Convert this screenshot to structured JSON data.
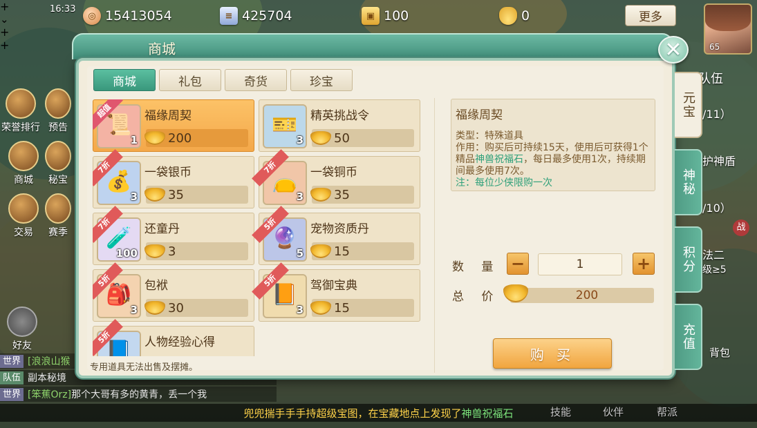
{
  "hud": {
    "clock": "16:33",
    "resources": [
      {
        "icon": "copper-coin-icon",
        "value": "15413054",
        "action": "plus"
      },
      {
        "icon": "silver-scroll-icon",
        "value": "425704",
        "action": "expand"
      },
      {
        "icon": "jade-token-icon",
        "value": "100",
        "action": "plus"
      },
      {
        "icon": "gold-ingot-icon",
        "value": "0",
        "action": "plus"
      }
    ],
    "more_label": "更多",
    "avatar_level": "65"
  },
  "left_menu": [
    {
      "label": "荣誉排行"
    },
    {
      "label": "预告"
    },
    {
      "label": "商城"
    },
    {
      "label": "秘宝"
    },
    {
      "label": "交易"
    },
    {
      "label": "赛季"
    },
    {
      "label": "好友"
    }
  ],
  "shop": {
    "title": "商城",
    "tabs": [
      {
        "label": "商城",
        "active": true
      },
      {
        "label": "礼包",
        "active": false
      },
      {
        "label": "奇货",
        "active": false
      },
      {
        "label": "珍宝",
        "active": false
      }
    ],
    "side_tabs": [
      {
        "label": "元宝",
        "active": true
      },
      {
        "label": "神秘",
        "active": false
      },
      {
        "label": "积分",
        "active": false
      },
      {
        "label": "充值",
        "active": false
      }
    ],
    "items": [
      {
        "name": "福缘周契",
        "badge": "超值",
        "stock": "1",
        "price": "200",
        "selected": true,
        "icon": "red-contract-icon",
        "icon_color": "#f06a6a"
      },
      {
        "name": "精英挑战令",
        "badge": "",
        "stock": "3",
        "price": "50",
        "selected": false,
        "icon": "blue-token-icon",
        "icon_color": "#7fb0d8"
      },
      {
        "name": "一袋银币",
        "badge": "7折",
        "stock": "3",
        "price": "35",
        "selected": false,
        "icon": "silver-bag-icon",
        "icon_color": "#8fb8e8"
      },
      {
        "name": "一袋铜币",
        "badge": "7折",
        "stock": "3",
        "price": "35",
        "selected": false,
        "icon": "copper-bag-icon",
        "icon_color": "#e89a6a"
      },
      {
        "name": "还童丹",
        "badge": "7折",
        "stock": "100",
        "price": "3",
        "selected": false,
        "icon": "pill-bottle-icon",
        "icon_color": "#c8b0e8"
      },
      {
        "name": "宠物资质丹",
        "badge": "5折",
        "stock": "5",
        "price": "15",
        "selected": false,
        "icon": "purple-orb-icon",
        "icon_color": "#8a6ad8"
      },
      {
        "name": "包袱",
        "badge": "5折",
        "stock": "3",
        "price": "30",
        "selected": false,
        "icon": "bundle-icon",
        "icon_color": "#f0a060"
      },
      {
        "name": "驾御宝典",
        "badge": "5折",
        "stock": "3",
        "price": "15",
        "selected": false,
        "icon": "book-icon",
        "icon_color": "#f0b040"
      },
      {
        "name": "人物经验心得",
        "badge": "5折",
        "stock": "",
        "price": "",
        "selected": false,
        "icon": "exp-scroll-icon",
        "icon_color": "#7fb0e0"
      }
    ],
    "detail": {
      "name": "福缘周契",
      "type_line": "类型：特殊道具",
      "effect_prefix": "作用：购买后可持续15天，使用后可获得1个精品",
      "effect_highlight": "神兽祝福石",
      "effect_suffix": "，每日最多使用1次，持续期间最多使用7次。",
      "extra": "注：每位少侠限购一次"
    },
    "quantity_label": "数 量",
    "quantity": "1",
    "total_label": "总 价",
    "total": "200",
    "buy_label": "购 买",
    "note": "专用道具无法出售及摆摊。"
  },
  "chat": [
    {
      "channel": "世界",
      "who": "[浪浪山猴",
      "text": ""
    },
    {
      "channel": "队伍",
      "who": "",
      "text": "副本秘境"
    },
    {
      "channel": "世界",
      "who": "[笨蕉Orz]",
      "text": "那个大哥有多的黄青，丢一个我"
    }
  ],
  "ticker": {
    "prefix": "兜兜揣手手手持超级宝图，在宝藏地点上发现了",
    "highlight": "神兽祝福石"
  },
  "bottom_nav": [
    "技能",
    "伙伴",
    "帮派"
  ],
  "right_peek": [
    "队伍",
    "/11）",
    "护神盾",
    "/10）",
    "战",
    "法二",
    "级≥5",
    "背包"
  ]
}
